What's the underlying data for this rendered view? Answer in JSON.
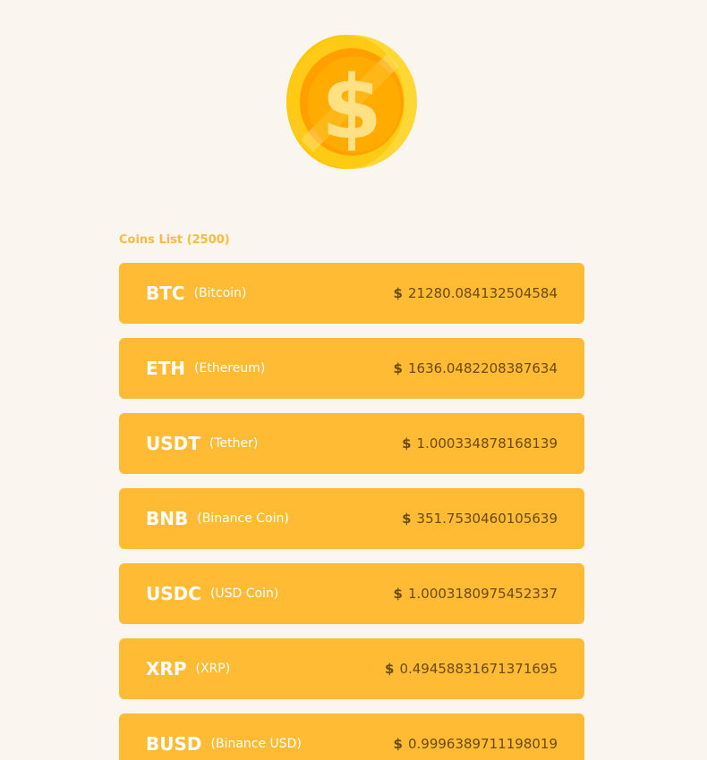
{
  "logo": {
    "icon": "dollar-coin-icon",
    "symbol": "$",
    "colors": {
      "outer": "#fdd835",
      "rim": "#ffc400",
      "inner": "#ffa000",
      "glyph": "#ffe082"
    }
  },
  "list": {
    "title": "Coins List (2500)",
    "currency_symbol": "$",
    "coins": [
      {
        "symbol": "BTC",
        "name": "(Bitcoin)",
        "price": "21280.084132504584"
      },
      {
        "symbol": "ETH",
        "name": "(Ethereum)",
        "price": "1636.0482208387634"
      },
      {
        "symbol": "USDT",
        "name": "(Tether)",
        "price": "1.000334878168139"
      },
      {
        "symbol": "BNB",
        "name": "(Binance Coin)",
        "price": "351.7530460105639"
      },
      {
        "symbol": "USDC",
        "name": "(USD Coin)",
        "price": "1.0003180975452337"
      },
      {
        "symbol": "XRP",
        "name": "(XRP)",
        "price": "0.49458831671371695"
      },
      {
        "symbol": "BUSD",
        "name": "(Binance USD)",
        "price": "0.9996389711198019"
      }
    ]
  },
  "theme": {
    "background": "#faf5ef",
    "card": "#ffbb33",
    "header_text": "#fbbb3c",
    "price_text": "#6b4a0e"
  }
}
